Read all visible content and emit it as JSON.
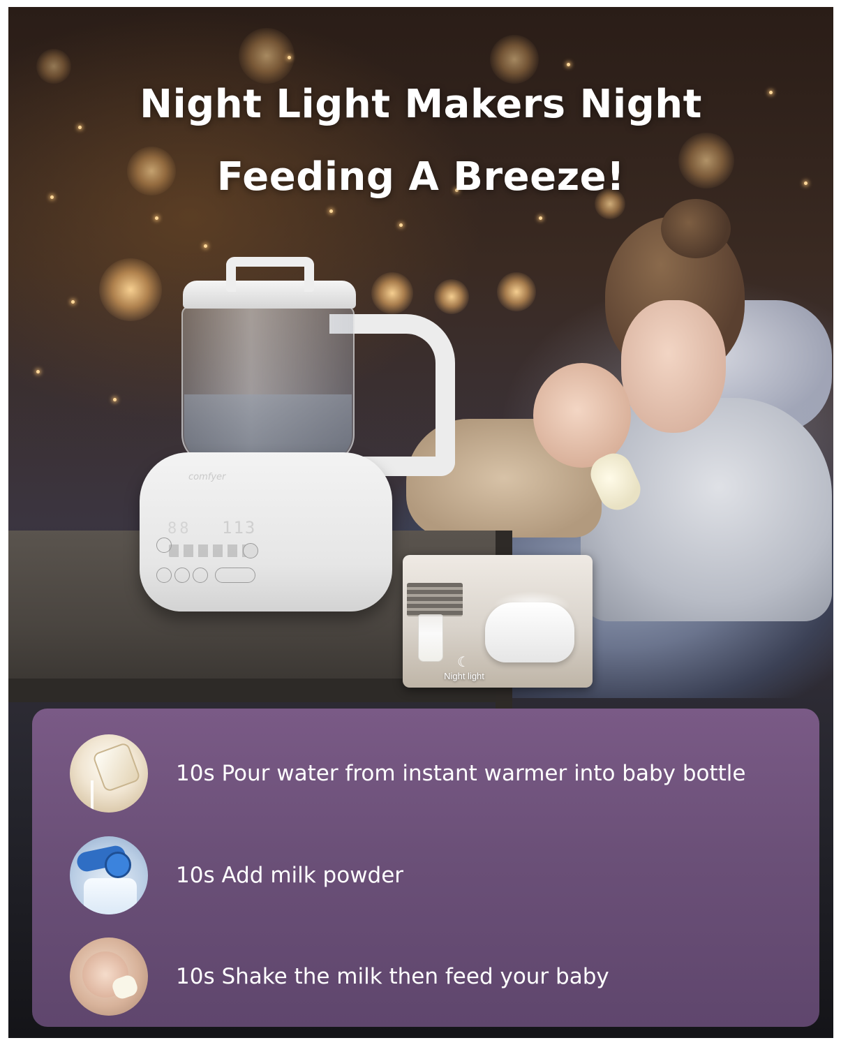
{
  "headline": {
    "line1": "Night Light Makers Night",
    "line2": "Feeding A Breeze!"
  },
  "product": {
    "brand": "comfyer",
    "display_current": "88",
    "display_preset": "113"
  },
  "inset": {
    "icon": "night-light-icon",
    "label": "Night light"
  },
  "steps": [
    {
      "thumbnail": "pouring-kettle-photo",
      "text": "10s Pour water from instant warmer into baby bottle"
    },
    {
      "thumbnail": "milk-powder-scoop-photo",
      "text": "10s Add milk powder"
    },
    {
      "thumbnail": "baby-feeding-photo",
      "text": "10s Shake the milk then feed your baby"
    }
  ],
  "colors": {
    "panel": "#6b5078",
    "title_text": "#ffffff"
  }
}
